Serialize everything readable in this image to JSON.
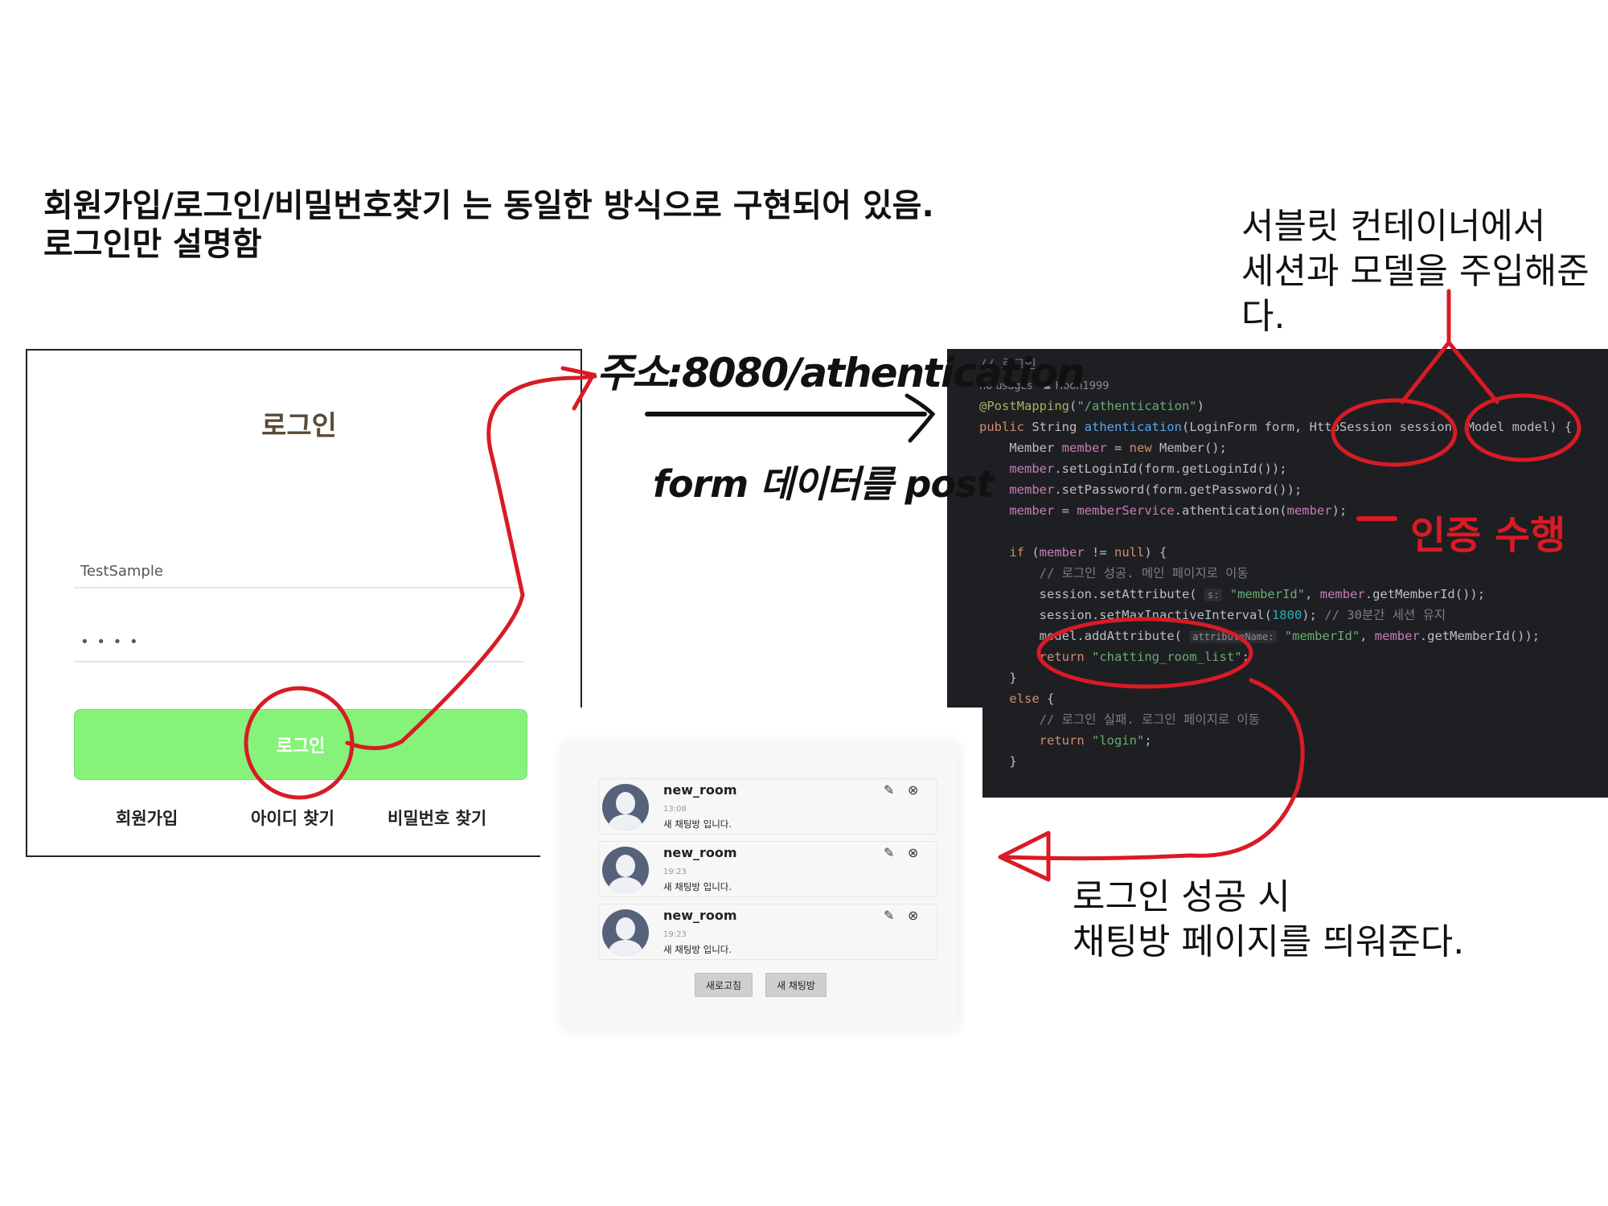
{
  "heading": {
    "line1": "회원가입/로그인/비밀번호찾기 는 동일한 방식으로 구현되어 있음.",
    "line2": "로그인만 설명함"
  },
  "notes": {
    "servlet_line1": "서블릿 컨테이너에서",
    "servlet_line2": "세션과 모델을 주입해준다.",
    "success_line1": "로그인 성공 시",
    "success_line2": "채팅방 페이지를 띄워준다."
  },
  "annotations": {
    "url": "주소:8080/athentication",
    "form_post": "form 데이터를 post",
    "auth": "인증 수행"
  },
  "login": {
    "title": "로그인",
    "id_value": "TestSample",
    "password_mask": "• • • •",
    "button_label": "로그인",
    "links": [
      "회원가입",
      "아이디 찾기",
      "비밀번호 찾기"
    ]
  },
  "code": {
    "comment_title": "// 로그인",
    "meta_usages": "no usages",
    "meta_author": "Hoon1999",
    "lines": [
      "@PostMapping(\"/athentication\")",
      "public String athentication(LoginForm form, HttpSession session, Model model) {",
      "    Member member = new Member();",
      "    member.setLoginId(form.getLoginId());",
      "    member.setPassword(form.getPassword());",
      "    member = memberService.athentication(member);",
      "",
      "    if (member != null) {",
      "        // 로그인 성공. 메인 페이지로 이동",
      "        session.setAttribute( s: \"memberId\", member.getMemberId());",
      "        session.setMaxInactiveInterval(1800); // 30분간 세션 유지",
      "        model.addAttribute( attributeName: \"memberId\", member.getMemberId());",
      "        return \"chatting_room_list\";",
      "    }",
      "    else {",
      "        // 로그인 실패. 로그인 페이지로 이동",
      "        return \"login\";",
      "    }"
    ]
  },
  "chat": {
    "rooms": [
      {
        "name": "new_room",
        "time": "13:08",
        "desc": "새 채팅방 입니다."
      },
      {
        "name": "new_room",
        "time": "19:23",
        "desc": "새 채팅방 입니다."
      },
      {
        "name": "new_room",
        "time": "19:23",
        "desc": "새 채팅방 입니다."
      }
    ],
    "refresh_label": "새로고침",
    "new_room_label": "새 채팅방"
  },
  "colors": {
    "annotation_red": "#d81b25",
    "login_button": "#87f27a",
    "code_background": "#1e1f22"
  }
}
